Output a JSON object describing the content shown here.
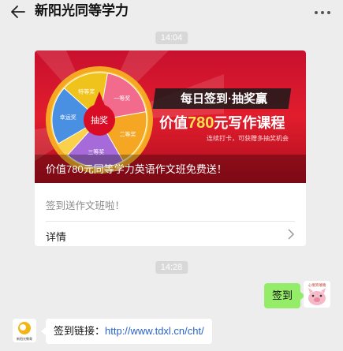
{
  "header": {
    "title": "新阳光同等学力",
    "back_icon": "back-arrow-icon",
    "more_icon": "more-dots-icon"
  },
  "messages": {
    "time1": "14:04",
    "time2": "14:28",
    "card": {
      "banner_caption": "价值780元同等学力英语作文班免费送！",
      "wheel": {
        "center": "抽奖",
        "segments": [
          "特等奖",
          "一等奖",
          "幸运奖",
          "二等奖",
          "三等奖"
        ]
      },
      "promo": {
        "line1": "每日签到·抽奖赢",
        "line2_prefix": "价值",
        "line2_amount": "780",
        "line2_suffix": "元写作课程",
        "sub": "连续打卡，可获赠多抽奖机会"
      },
      "description": "签到送作文班啦！",
      "detail_label": "详情"
    },
    "user_message": "签到",
    "bot_message_label": "签到链接：",
    "bot_message_link": "http://www.tdxl.cn/cht/",
    "user_avatar_text": "心情笑嘻嘻",
    "bot_avatar_text": "新阳光教育"
  },
  "colors": {
    "background": "#ededed",
    "bubble_green": "#95ec69",
    "link": "#2a63c8",
    "banner_red": "#e11d2d"
  }
}
